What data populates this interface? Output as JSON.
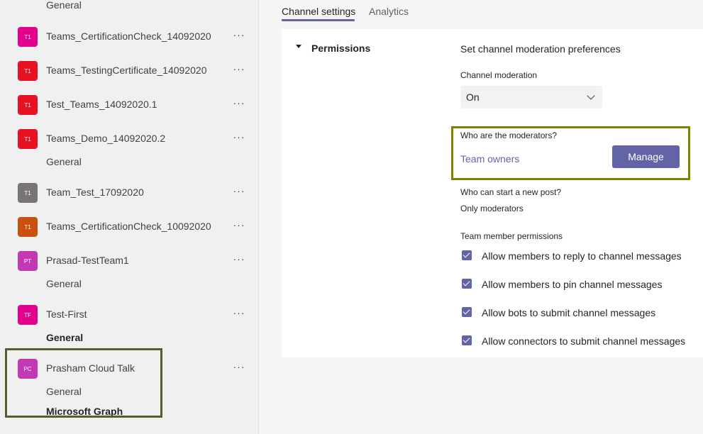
{
  "sidebar": {
    "top_channel": "General",
    "teams": [
      {
        "initials": "T1",
        "name": "Teams_CertificationCheck_14092020",
        "color": "#e3008c"
      },
      {
        "initials": "T1",
        "name": "Teams_TestingCertificate_14092020",
        "color": "#e81123"
      },
      {
        "initials": "T1",
        "name": "Test_Teams_14092020.1",
        "color": "#e81123"
      },
      {
        "initials": "T1",
        "name": "Teams_Demo_14092020.2",
        "color": "#e81123",
        "channels": [
          "General"
        ]
      },
      {
        "initials": "T1",
        "name": "Team_Test_17092020",
        "color": "#7a7574"
      },
      {
        "initials": "T1",
        "name": "Teams_CertificationCheck_10092020",
        "color": "#ca5010"
      },
      {
        "initials": "PT",
        "name": "Prasad-TestTeam1",
        "color": "#c239b3",
        "channels": [
          "General"
        ]
      },
      {
        "initials": "TF",
        "name": "Test-First",
        "color": "#e3008c",
        "channels": [
          "General"
        ]
      },
      {
        "initials": "PC",
        "name": "Prasham Cloud Talk",
        "color": "#c239b3",
        "channels": [
          "General",
          "Microsoft Graph"
        ]
      }
    ],
    "more_glyph": "···"
  },
  "tabs": [
    {
      "label": "Channel settings",
      "active": true
    },
    {
      "label": "Analytics",
      "active": false
    }
  ],
  "permissions": {
    "section_title": "Permissions",
    "heading": "Set channel moderation preferences",
    "moderation_label": "Channel moderation",
    "moderation_value": "On",
    "moderators_label": "Who are the moderators?",
    "moderators_value": "Team owners",
    "manage_button": "Manage",
    "new_post_label": "Who can start a new post?",
    "new_post_value": "Only moderators",
    "member_permissions_label": "Team member permissions",
    "checkboxes": [
      {
        "label": "Allow members to reply to channel messages",
        "checked": true
      },
      {
        "label": "Allow members to pin channel messages",
        "checked": true
      },
      {
        "label": "Allow bots to submit channel messages",
        "checked": true
      },
      {
        "label": "Allow connectors to submit channel messages",
        "checked": true
      }
    ]
  },
  "colors": {
    "accent": "#6264a7",
    "highlight_sidebar": "#4f6228",
    "highlight_moderators": "#7f7f00"
  }
}
